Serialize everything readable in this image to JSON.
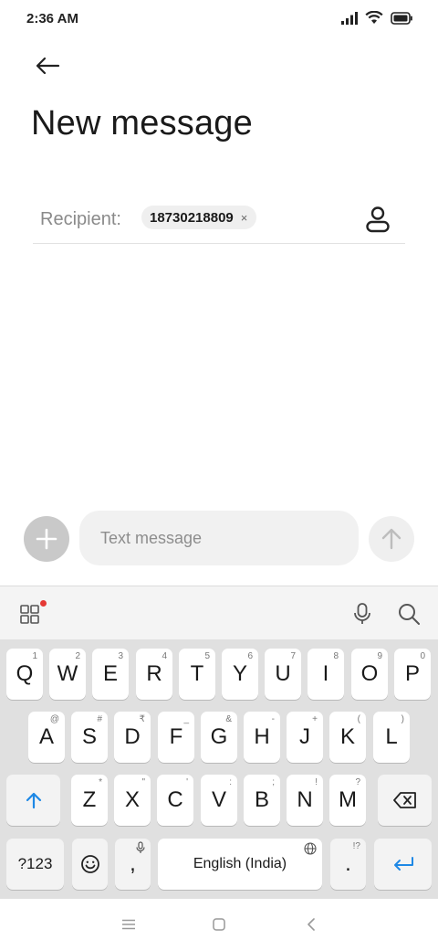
{
  "status_bar": {
    "time": "2:36 AM"
  },
  "header": {
    "title": "New message"
  },
  "recipient": {
    "label": "Recipient:",
    "chip": "18730218809",
    "chip_close": "×"
  },
  "compose": {
    "placeholder": "Text message"
  },
  "keyboard": {
    "row1": [
      {
        "label": "Q",
        "hint": "1"
      },
      {
        "label": "W",
        "hint": "2"
      },
      {
        "label": "E",
        "hint": "3"
      },
      {
        "label": "R",
        "hint": "4"
      },
      {
        "label": "T",
        "hint": "5"
      },
      {
        "label": "Y",
        "hint": "6"
      },
      {
        "label": "U",
        "hint": "7"
      },
      {
        "label": "I",
        "hint": "8"
      },
      {
        "label": "O",
        "hint": "9"
      },
      {
        "label": "P",
        "hint": "0"
      }
    ],
    "row2": [
      {
        "label": "A",
        "hint": "@"
      },
      {
        "label": "S",
        "hint": "#"
      },
      {
        "label": "D",
        "hint": "₹"
      },
      {
        "label": "F",
        "hint": "_"
      },
      {
        "label": "G",
        "hint": "&"
      },
      {
        "label": "H",
        "hint": "-"
      },
      {
        "label": "J",
        "hint": "+"
      },
      {
        "label": "K",
        "hint": "("
      },
      {
        "label": "L",
        "hint": ")"
      }
    ],
    "row3": [
      {
        "label": "Z",
        "hint": "*"
      },
      {
        "label": "X",
        "hint": "\""
      },
      {
        "label": "C",
        "hint": "'"
      },
      {
        "label": "V",
        "hint": ":"
      },
      {
        "label": "B",
        "hint": ";"
      },
      {
        "label": "N",
        "hint": "!"
      },
      {
        "label": "M",
        "hint": "?"
      }
    ],
    "symbols_label": "?123",
    "comma_label": ",",
    "space_label": "English (India)",
    "period_label": ".",
    "period_hint": "!?"
  },
  "colors": {
    "accent": "#1e88e5",
    "notification_dot": "#e53935"
  }
}
